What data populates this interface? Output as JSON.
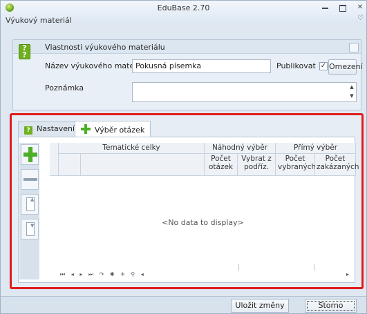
{
  "window": {
    "title": "EduBase 2.70",
    "document_title": "Výukový materiál"
  },
  "properties": {
    "header": "Vlastnosti výukového materiálu",
    "name_label": "Název výukového materiálu",
    "name_value": "Pokusná písemka",
    "publish_label": "Publikovat",
    "publish_checked": true,
    "restrict_button": "Omezení",
    "note_label": "Poznámka",
    "note_value": ""
  },
  "tabs": [
    {
      "label": "Nastavení",
      "active": false
    },
    {
      "label": "Výběr otázek",
      "active": true
    }
  ],
  "grid": {
    "headers": {
      "thematic": "Tematické celky",
      "random": "Náhodný výběr",
      "direct": "Přímý výběr",
      "count": "Počet otázek",
      "select_sub": "Vybrat z podříz.",
      "selected": "Počet vybraných",
      "forbidden": "Počet zakázaných"
    },
    "empty_text": "<No data to display>"
  },
  "footer": {
    "save": "Uložit změny",
    "cancel": "Storno"
  }
}
